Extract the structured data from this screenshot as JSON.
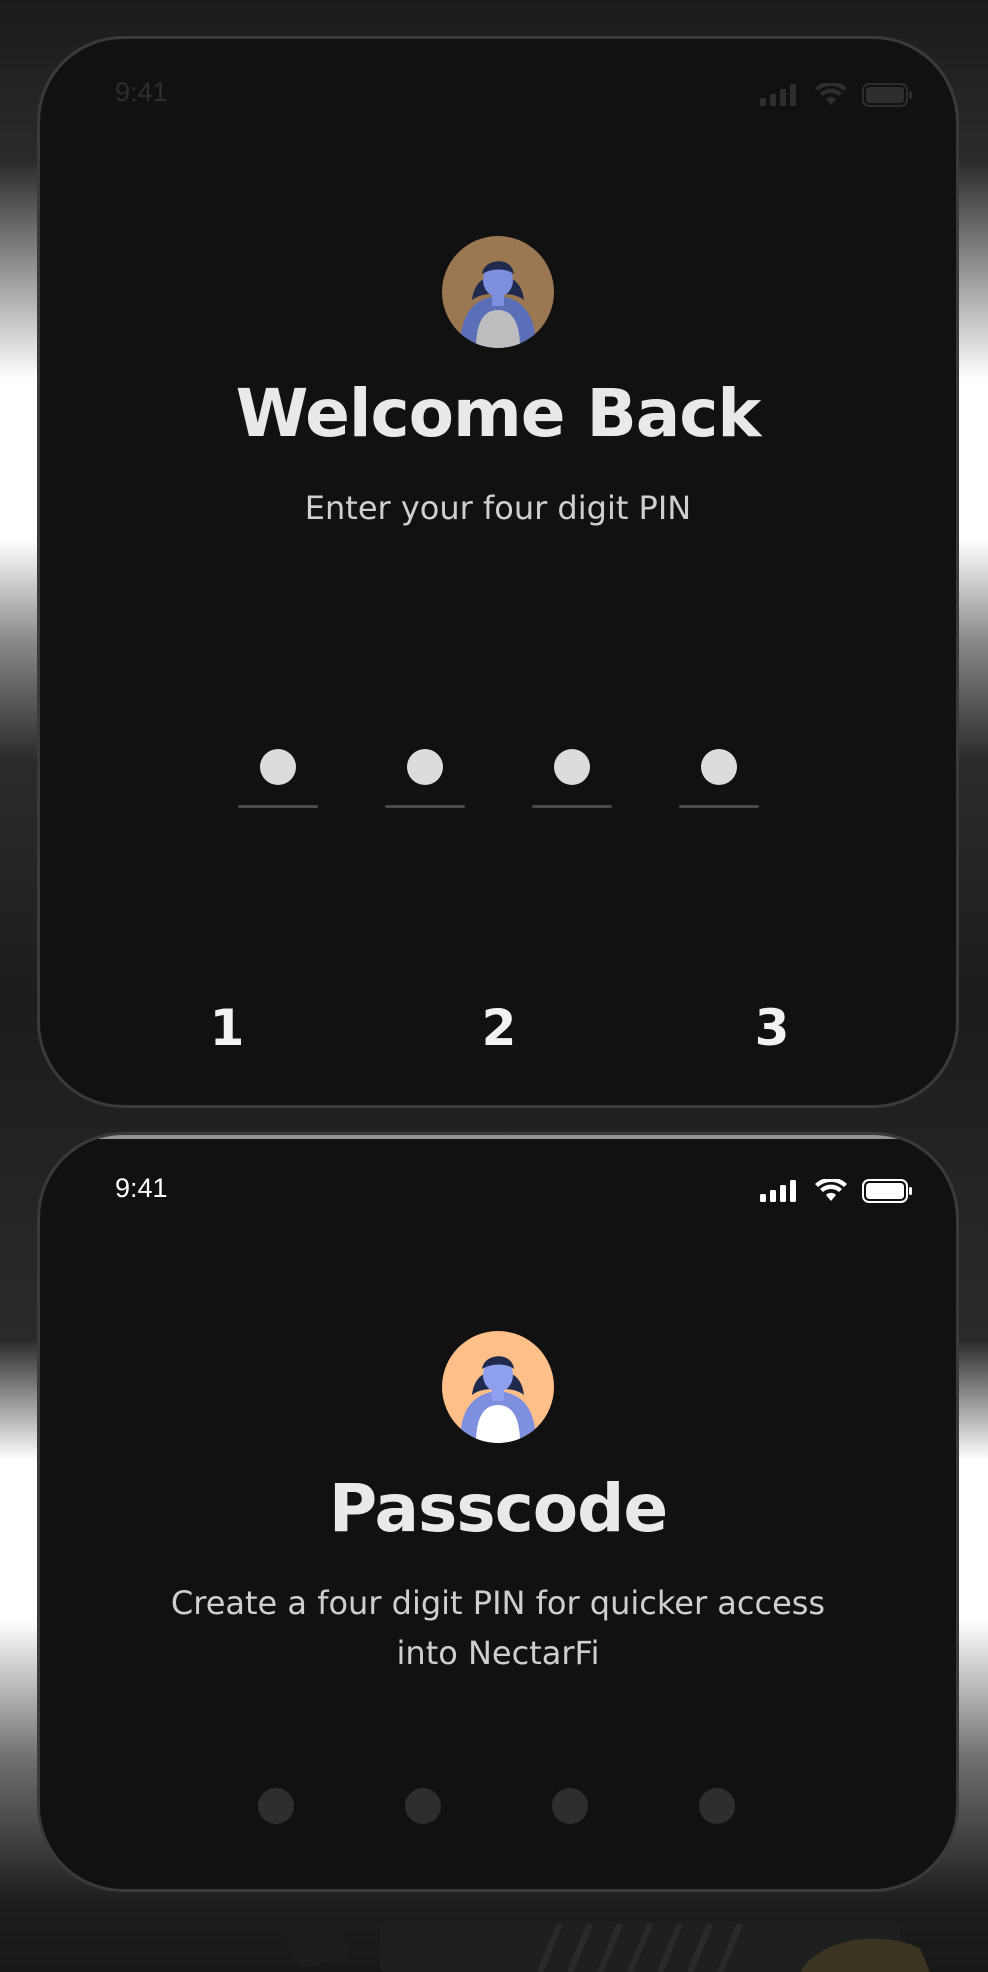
{
  "screen1": {
    "status_time": "9:41",
    "title": "Welcome Back",
    "subtitle": "Enter your four digit PIN",
    "pin_count": 4,
    "keypad": [
      "1",
      "2",
      "3"
    ]
  },
  "screen2": {
    "status_time": "9:41",
    "title": "Passcode",
    "subtitle": "Create a four digit PIN for quicker access into NectarFi"
  },
  "icons": [
    "signal-icon",
    "wifi-icon",
    "battery-icon",
    "avatar-illustration"
  ],
  "colors": {
    "phone_bg": "#111112",
    "text_primary": "#e9e9e9",
    "pin_dot": "#dcdcdc",
    "avatar1_bg": "#9b7752",
    "avatar2_bg": "#ffbf88",
    "figure_blue": "#7f8fe0"
  }
}
